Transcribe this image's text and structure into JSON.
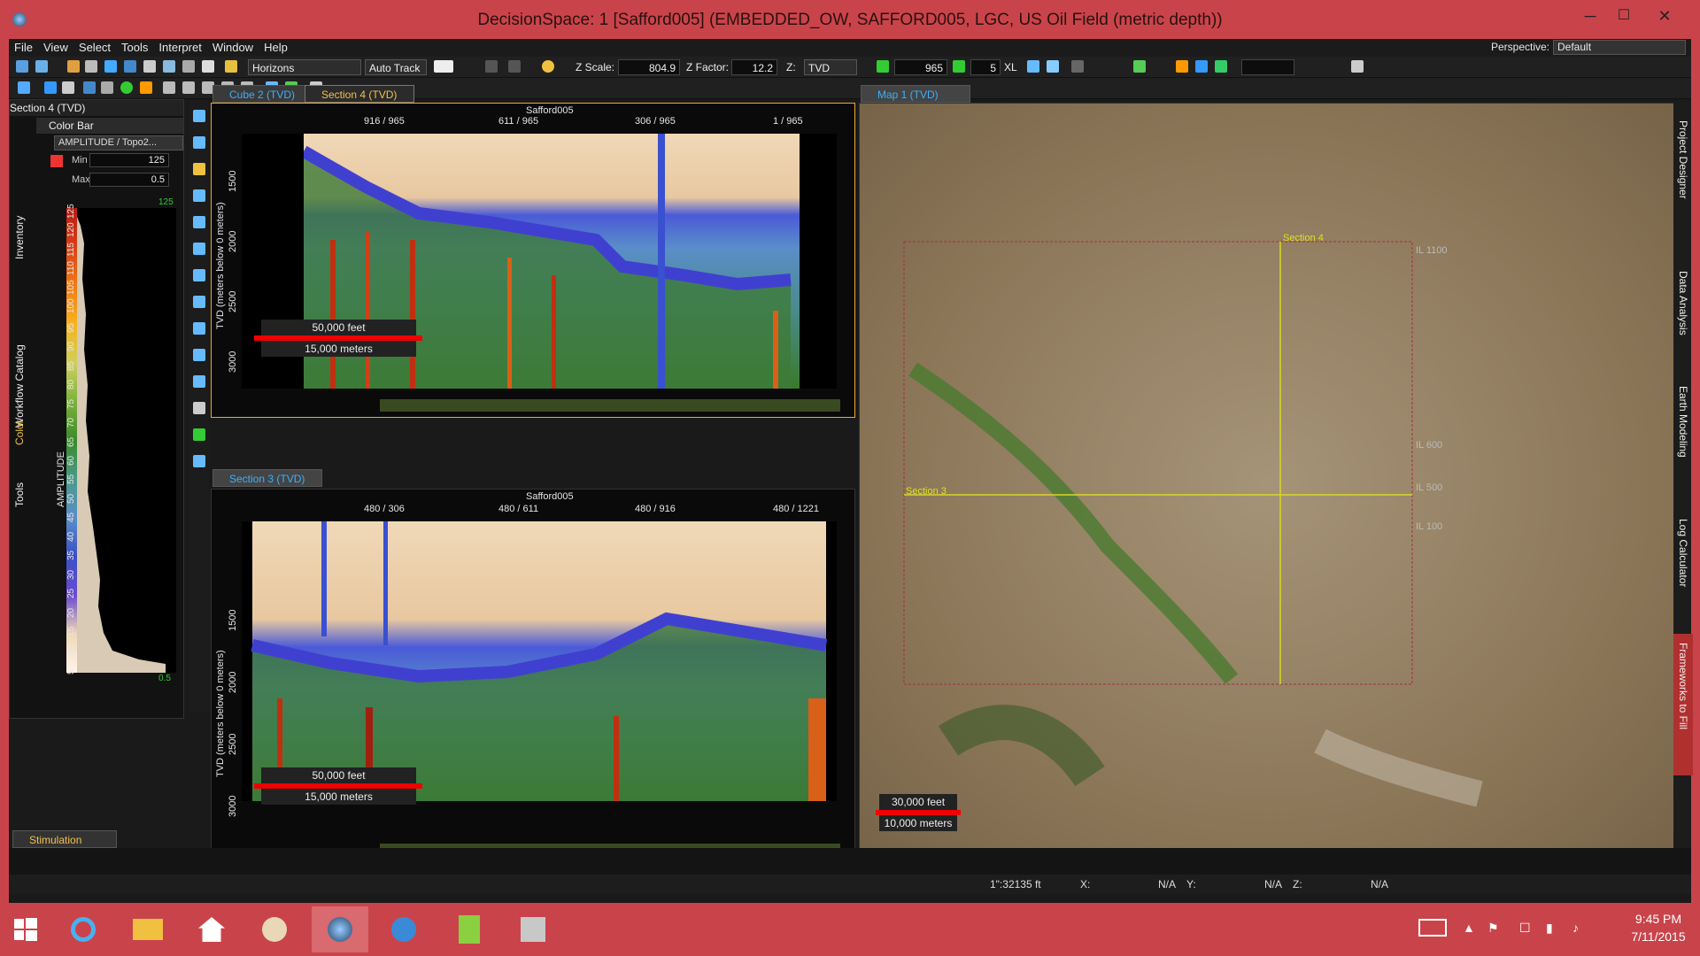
{
  "window": {
    "title": "DecisionSpace: 1 [Safford005] (EMBEDDED_OW, SAFFORD005, LGC, US Oil Field (metric depth))",
    "minimize": "─",
    "maximize": "☐",
    "close": "✕"
  },
  "menu": [
    "File",
    "View",
    "Select",
    "Tools",
    "Interpret",
    "Window",
    "Help"
  ],
  "perspective": {
    "label": "Perspective:",
    "value": "Default"
  },
  "toolbar": {
    "horizons": "Horizons",
    "autotrack": "Auto Track",
    "zscale_label": "Z Scale:",
    "zscale_value": "804.9",
    "zfactor_label": "Z Factor:",
    "zfactor_value": "12.2",
    "z_label": "Z:",
    "z_value": "TVD",
    "line_value": "965",
    "step_value": "5",
    "xl_label": "XL"
  },
  "left_panel": {
    "header": "Section 4 (TVD)",
    "colorbar_title": "Color Bar",
    "attribute": "AMPLITUDE / Topo2...",
    "min_label": "Min",
    "min_value": "125",
    "max_label": "Max",
    "max_value": "0.5",
    "top_marker": "125",
    "bottom_marker": "0.5",
    "axis_label": "AMPLITUDE",
    "ticks": [
      "125",
      "120",
      "115",
      "110",
      "105",
      "100",
      "95",
      "90",
      "85",
      "80",
      "75",
      "70",
      "65",
      "60",
      "55",
      "50",
      "45",
      "40",
      "35",
      "30",
      "25",
      "20",
      "15",
      "10",
      "5"
    ],
    "side_tabs": [
      "Inventory",
      "Workflow Catalog",
      "Color",
      "Tools"
    ]
  },
  "tabs_top": [
    "Cube 2 (TVD)",
    "Section 4 (TVD)"
  ],
  "section4": {
    "title": "Safford005",
    "ticks": [
      "916 / 965",
      "611 / 965",
      "306 / 965",
      "1 / 965"
    ],
    "ylabel": "TVD (meters below 0 meters)",
    "yticks": [
      "1500",
      "2000",
      "2500",
      "3000"
    ],
    "scale_feet": "50,000 feet",
    "scale_meters": "15,000 meters"
  },
  "section3": {
    "tab": "Section 3 (TVD)",
    "title": "Safford005",
    "ticks": [
      "480 / 306",
      "480 / 611",
      "480 / 916",
      "480 / 1221"
    ],
    "ylabel": "TVD (meters below 0 meters)",
    "yticks": [
      "1500",
      "2000",
      "2500",
      "3000"
    ],
    "scale_feet": "50,000 feet",
    "scale_meters": "15,000 meters"
  },
  "map": {
    "tab": "Map 1 (TVD)",
    "section4_label": "Section 4",
    "section3_label": "Section 3",
    "il_labels": [
      "IL 1100",
      "IL 600",
      "IL 500",
      "IL 100"
    ],
    "scale_feet": "30,000 feet",
    "scale_meters": "10,000 meters"
  },
  "right_tabs": [
    "Project Designer",
    "Data Analysis",
    "Earth Modeling",
    "Log Calculator",
    "Frameworks to Fill"
  ],
  "bottom_tab": "Stimulation",
  "status": {
    "scale": "1\":32135 ft",
    "x_label": "X:",
    "x_value": "N/A",
    "y_label": "Y:",
    "y_value": "N/A",
    "z_label": "Z:",
    "z_value": "N/A"
  },
  "taskbar": {
    "time": "9:45 PM",
    "date": "7/11/2015"
  },
  "colors": {
    "accent_orange": "#f2c14a",
    "tab_blue": "#39b0ff",
    "title_red": "#c9444a",
    "scale_red": "#e00000"
  }
}
